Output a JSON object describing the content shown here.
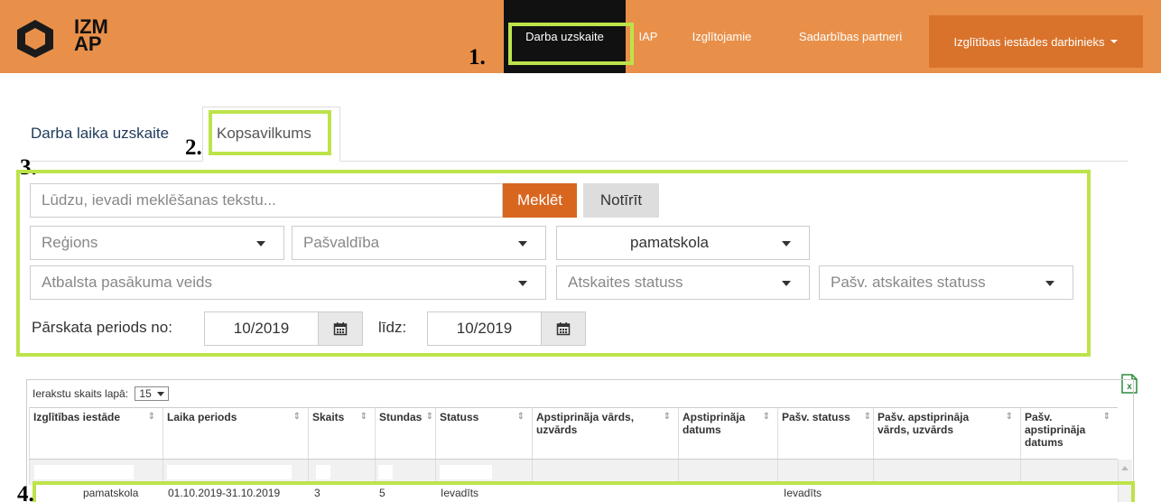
{
  "header": {
    "logo_line1": "IZM",
    "logo_line2": "AP",
    "nav": {
      "active": "Darba uzskaite",
      "iap": "IAP",
      "izglitojamie": "Izglītojamie",
      "sadarbibas": "Sadarbības partneri",
      "user_menu": "Izglītības iestādes darbinieks"
    }
  },
  "annotations": [
    "1.",
    "2.",
    "3.",
    "4."
  ],
  "tabs": {
    "tab1": "Darba laika uzskaite",
    "tab2": "Kopsavilkums"
  },
  "filters": {
    "search_placeholder": "Lūdzu, ievadi meklēšanas tekstu...",
    "search_button": "Meklēt",
    "clear_button": "Notīrīt",
    "region": "Reģions",
    "municipality": "Pašvaldība",
    "school_type": "pamatskola",
    "support_type": "Atbalsta pasākuma veids",
    "report_status": "Atskaites statuss",
    "municipal_status": "Pašv. atskaites statuss",
    "period_from_label": "Pārskata periods no:",
    "period_from": "10/2019",
    "period_to_label": "līdz:",
    "period_to": "10/2019"
  },
  "table": {
    "page_size_label": "Ierakstu skaits lapā:",
    "page_size": "15",
    "columns": [
      "Izglītības iestāde",
      "Laika periods",
      "Skaits",
      "Stundas",
      "Statuss",
      "Apstiprinãja vārds, uzvārds",
      "Apstiprinãja datums",
      "Pašv. statuss",
      "Pašv. apstiprināja vārds, uzvārds",
      "Pašv. apstiprināja datums"
    ],
    "row": {
      "iestade": "pamatskola",
      "periods": "01.10.2019-31.10.2019",
      "skaits": "3",
      "stundas": "5",
      "statuss": "Ievadīts",
      "pasv_statuss": "Ievadīts"
    }
  },
  "colors": {
    "header": "#e8904a",
    "active_nav": "#111111",
    "accent_button": "#d9661f",
    "annotation": "#bde34a"
  }
}
